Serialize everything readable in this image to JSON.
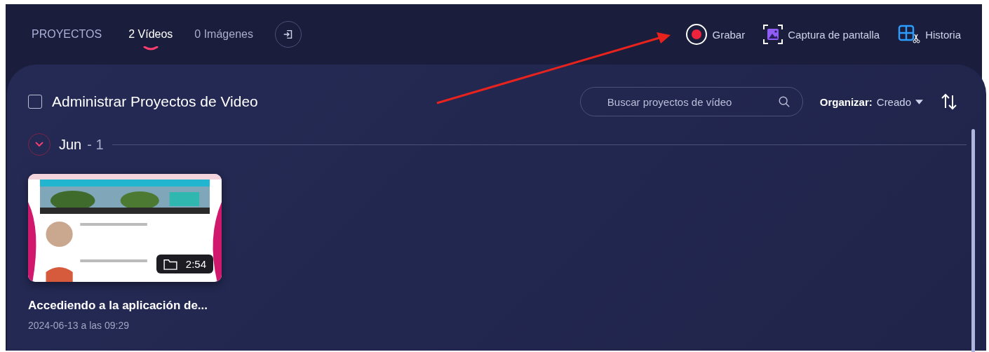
{
  "nav": {
    "title": "PROYECTOS",
    "tabs": [
      {
        "label": "2 Vídeos",
        "selected": true
      },
      {
        "label": "0 Imágenes",
        "selected": false
      }
    ]
  },
  "actions": [
    {
      "kind": "record",
      "label": "Grabar"
    },
    {
      "kind": "screenshot",
      "label": "Captura de pantalla"
    },
    {
      "kind": "history",
      "label": "Historia"
    }
  ],
  "manage": {
    "label": "Administrar Proyectos de Video",
    "checked": false
  },
  "search": {
    "placeholder": "Buscar proyectos de vídeo"
  },
  "sort": {
    "label": "Organizar:",
    "value": "Creado"
  },
  "groups": [
    {
      "month": "Jun",
      "count": "- 1",
      "expanded": true,
      "videos": [
        {
          "title": "Accediendo a la aplicación de...",
          "date": "2024-06-13 a las 09:29",
          "duration": "2:54"
        }
      ]
    }
  ]
}
